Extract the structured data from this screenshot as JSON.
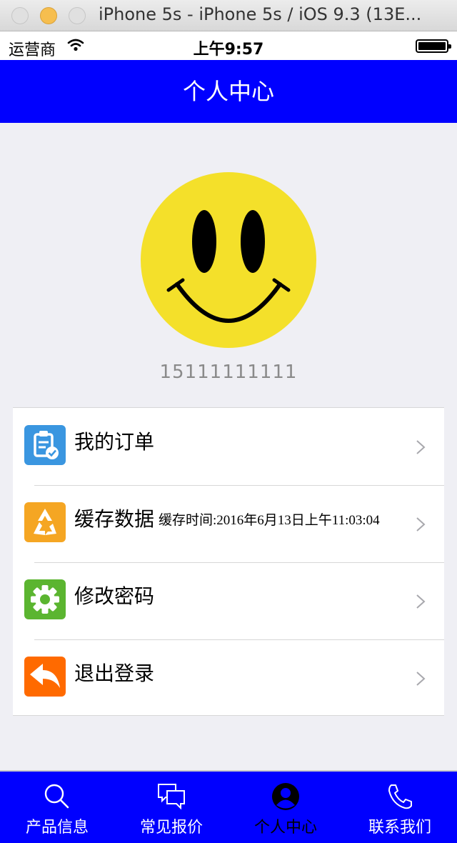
{
  "window": {
    "title": "iPhone 5s - iPhone 5s / iOS 9.3 (13E..."
  },
  "status_bar": {
    "carrier": "运营商",
    "time": "上午9:57"
  },
  "nav": {
    "title": "个人中心"
  },
  "profile": {
    "phone": "15111111111"
  },
  "menu": {
    "items": [
      {
        "label": "我的订单",
        "icon": "order-icon",
        "color": "#3a96e0"
      },
      {
        "label": "缓存数据",
        "sub": "缓存时间:2016年6月13日上午11:03:04",
        "icon": "recycle-icon",
        "color": "#f5a623"
      },
      {
        "label": "修改密码",
        "icon": "gear-icon",
        "color": "#5bb530"
      },
      {
        "label": "退出登录",
        "icon": "reply-icon",
        "color": "#ff6a00"
      }
    ]
  },
  "tab_bar": {
    "active": 2,
    "items": [
      {
        "label": "产品信息",
        "icon": "search-icon"
      },
      {
        "label": "常见报价",
        "icon": "chat-icon"
      },
      {
        "label": "个人中心",
        "icon": "user-icon"
      },
      {
        "label": "联系我们",
        "icon": "phone-icon"
      }
    ]
  },
  "colors": {
    "brand_blue": "#0000ff",
    "smiley_yellow": "#f4e02a"
  }
}
